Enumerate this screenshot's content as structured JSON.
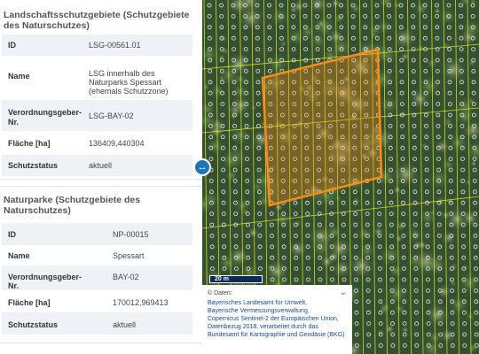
{
  "panel": {
    "section1": {
      "title": "Landschaftsschutzgebiete (Schutzgebiete des Naturschutzes)",
      "rows": [
        {
          "key": "ID",
          "value": "LSG-00561.01"
        },
        {
          "key": "Name",
          "value": "LSG innerhalb des Naturparks Spessart (ehemals Schutzzone)"
        },
        {
          "key": "Verordnungsgeber-Nr.",
          "value": "LSG-BAY-02"
        },
        {
          "key": "Fläche [ha]",
          "value": "136409,440304"
        },
        {
          "key": "Schutzstatus",
          "value": "aktuell"
        }
      ]
    },
    "section2": {
      "title": "Naturparke (Schutzgebiete des Naturschutzes)",
      "rows": [
        {
          "key": "ID",
          "value": "NP-00015"
        },
        {
          "key": "Name",
          "value": "Spessart"
        },
        {
          "key": "Verordnungsgeber-Nr.",
          "value": "BAY-02"
        },
        {
          "key": "Fläche [ha]",
          "value": "170012,969413"
        },
        {
          "key": "Schutzstatus",
          "value": "aktuell"
        }
      ]
    }
  },
  "map": {
    "scalebar_label": "20 m",
    "attribution": {
      "header": "© Daten:",
      "lines": [
        "Bayerisches Landesamt für Umwelt,",
        "Bayerische Vermessungsverwaltung,",
        "Copernicus Sentinel-2 der Europäischen Union, Datenbezug 2018, verarbeitet durch das Bundesamt für Kartographie und Geodäsie (BKG)"
      ]
    },
    "colors": {
      "highlight": "#ff8c1a",
      "grid": "#e8ef3a",
      "accent": "#1f73b7"
    }
  },
  "icons": {
    "splitter": "resize-horizontal-icon",
    "attribution_toggle": "chevron-down-icon"
  }
}
